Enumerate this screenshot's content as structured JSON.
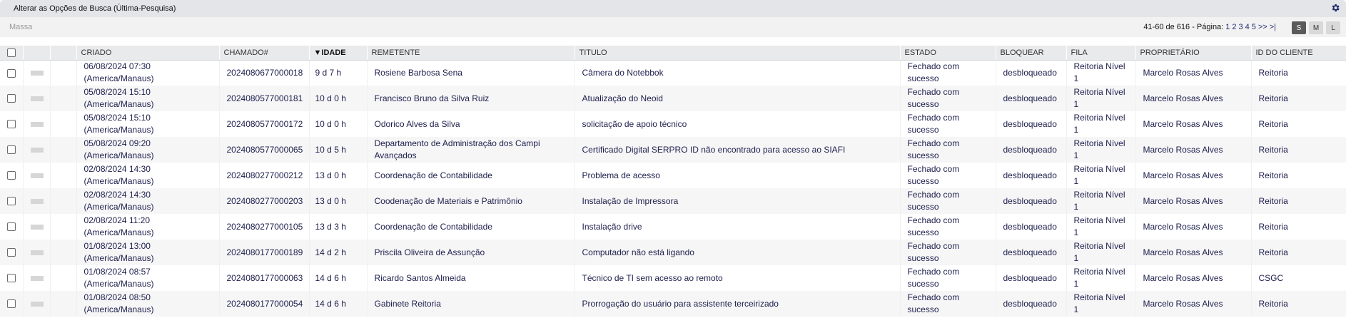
{
  "header": {
    "title": "Alterar as Opções de Busca (Última-Pesquisa)",
    "settings_icon": "gear-icon"
  },
  "toolbar": {
    "bulk_label": "Massa",
    "page_info": "41-60 de 616 - Página:",
    "pages": [
      "1",
      "2",
      "3",
      "4",
      "5",
      ">>",
      ">|"
    ],
    "sizes": [
      "S",
      "M",
      "L"
    ],
    "active_size": "S"
  },
  "columns": {
    "created": "CRIADO",
    "ticket": "CHAMADO#",
    "age": "▼IDADE",
    "sender": "REMETENTE",
    "title": "TITULO",
    "state": "ESTADO",
    "lock": "BLOQUEAR",
    "queue": "FILA",
    "owner": "PROPRIETÁRIO",
    "customer": "ID DO CLIENTE"
  },
  "rows": [
    {
      "created_date": "06/08/2024 07:30",
      "created_tz": "(America/Manaus)",
      "ticket": "2024080677000018",
      "age": "9 d 7 h",
      "sender": "Rosiene Barbosa Sena",
      "title": "Câmera do Notebbok",
      "state1": "Fechado com",
      "state2": "sucesso",
      "lock": "desbloqueado",
      "queue1": "Reitoria Nível",
      "queue2": "1",
      "owner": "Marcelo Rosas Alves",
      "customer": "Reitoria"
    },
    {
      "created_date": "05/08/2024 15:10",
      "created_tz": "(America/Manaus)",
      "ticket": "2024080577000181",
      "age": "10 d 0 h",
      "sender": "Francisco Bruno da Silva Ruiz",
      "title": "Atualização do Neoid",
      "state1": "Fechado com",
      "state2": "sucesso",
      "lock": "desbloqueado",
      "queue1": "Reitoria Nível",
      "queue2": "1",
      "owner": "Marcelo Rosas Alves",
      "customer": "Reitoria"
    },
    {
      "created_date": "05/08/2024 15:10",
      "created_tz": "(America/Manaus)",
      "ticket": "2024080577000172",
      "age": "10 d 0 h",
      "sender": "Odorico Alves da Silva",
      "title": "solicitação de apoio técnico",
      "state1": "Fechado com",
      "state2": "sucesso",
      "lock": "desbloqueado",
      "queue1": "Reitoria Nível",
      "queue2": "1",
      "owner": "Marcelo Rosas Alves",
      "customer": "Reitoria"
    },
    {
      "created_date": "05/08/2024 09:20",
      "created_tz": "(America/Manaus)",
      "ticket": "2024080577000065",
      "age": "10 d 5 h",
      "sender": "Departamento de Administração dos Campi Avançados",
      "title": "Certificado Digital SERPRO ID não encontrado para acesso ao SIAFI",
      "state1": "Fechado com",
      "state2": "sucesso",
      "lock": "desbloqueado",
      "queue1": "Reitoria Nível",
      "queue2": "1",
      "owner": "Marcelo Rosas Alves",
      "customer": "Reitoria"
    },
    {
      "created_date": "02/08/2024 14:30",
      "created_tz": "(America/Manaus)",
      "ticket": "2024080277000212",
      "age": "13 d 0 h",
      "sender": "Coordenação de Contabilidade",
      "title": "Problema de acesso",
      "state1": "Fechado com",
      "state2": "sucesso",
      "lock": "desbloqueado",
      "queue1": "Reitoria Nível",
      "queue2": "1",
      "owner": "Marcelo Rosas Alves",
      "customer": "Reitoria"
    },
    {
      "created_date": "02/08/2024 14:30",
      "created_tz": "(America/Manaus)",
      "ticket": "2024080277000203",
      "age": "13 d 0 h",
      "sender": "Coodenação de Materiais e Patrimônio",
      "title": "Instalação de Impressora",
      "state1": "Fechado com",
      "state2": "sucesso",
      "lock": "desbloqueado",
      "queue1": "Reitoria Nível",
      "queue2": "1",
      "owner": "Marcelo Rosas Alves",
      "customer": "Reitoria"
    },
    {
      "created_date": "02/08/2024 11:20",
      "created_tz": "(America/Manaus)",
      "ticket": "2024080277000105",
      "age": "13 d 3 h",
      "sender": "Coordenação de Contabilidade",
      "title": "Instalação drive",
      "state1": "Fechado com",
      "state2": "sucesso",
      "lock": "desbloqueado",
      "queue1": "Reitoria Nível",
      "queue2": "1",
      "owner": "Marcelo Rosas Alves",
      "customer": "Reitoria"
    },
    {
      "created_date": "01/08/2024 13:00",
      "created_tz": "(America/Manaus)",
      "ticket": "2024080177000189",
      "age": "14 d 2 h",
      "sender": "Priscila Oliveira de Assunção",
      "title": "Computador não está ligando",
      "state1": "Fechado com",
      "state2": "sucesso",
      "lock": "desbloqueado",
      "queue1": "Reitoria Nível",
      "queue2": "1",
      "owner": "Marcelo Rosas Alves",
      "customer": "Reitoria"
    },
    {
      "created_date": "01/08/2024 08:57",
      "created_tz": "(America/Manaus)",
      "ticket": "2024080177000063",
      "age": "14 d 6 h",
      "sender": "Ricardo Santos Almeida",
      "title": "Técnico de TI sem acesso ao remoto",
      "state1": "Fechado com",
      "state2": "sucesso",
      "lock": "desbloqueado",
      "queue1": "Reitoria Nível",
      "queue2": "1",
      "owner": "Marcelo Rosas Alves",
      "customer": "CSGC"
    },
    {
      "created_date": "01/08/2024 08:50",
      "created_tz": "(America/Manaus)",
      "ticket": "2024080177000054",
      "age": "14 d 6 h",
      "sender": "Gabinete Reitoria",
      "title": "Prorrogação do usuário para assistente terceirizado",
      "state1": "Fechado com",
      "state2": "sucesso",
      "lock": "desbloqueado",
      "queue1": "Reitoria Nível",
      "queue2": "1",
      "owner": "Marcelo Rosas Alves",
      "customer": "Reitoria"
    }
  ]
}
